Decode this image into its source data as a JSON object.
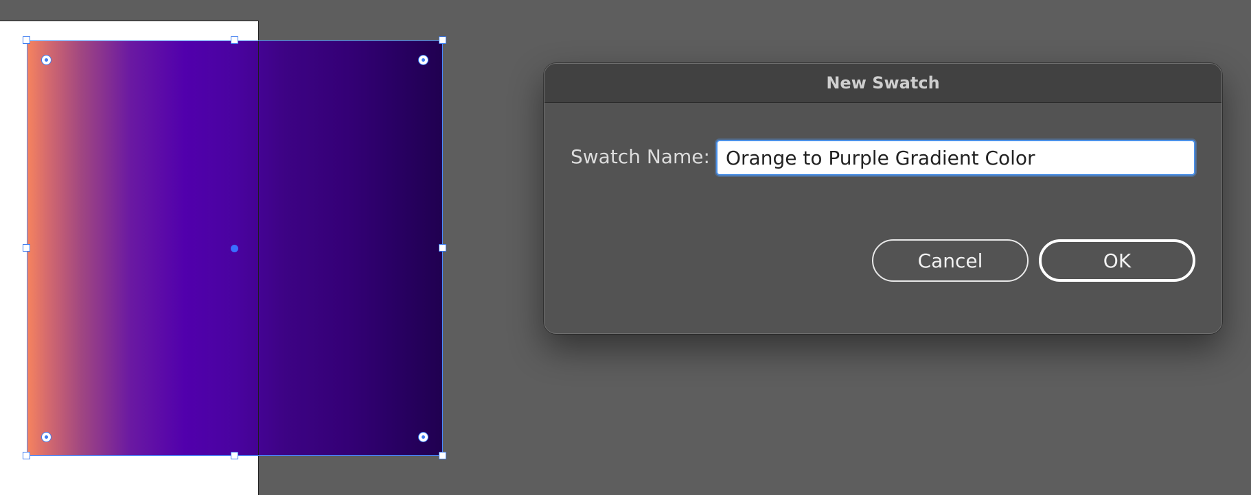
{
  "canvas": {
    "gradient": {
      "name": "orange-to-purple",
      "colors": [
        "#f7845e",
        "#a14781",
        "#5100ac",
        "#340076",
        "#200050"
      ]
    },
    "selection_color": "#3d7cf0"
  },
  "dialog": {
    "title": "New Swatch",
    "swatch_name_label": "Swatch Name:",
    "swatch_name_value": "Orange to Purple Gradient Color",
    "cancel_label": "Cancel",
    "ok_label": "OK",
    "focus_color": "#4a90e8"
  }
}
